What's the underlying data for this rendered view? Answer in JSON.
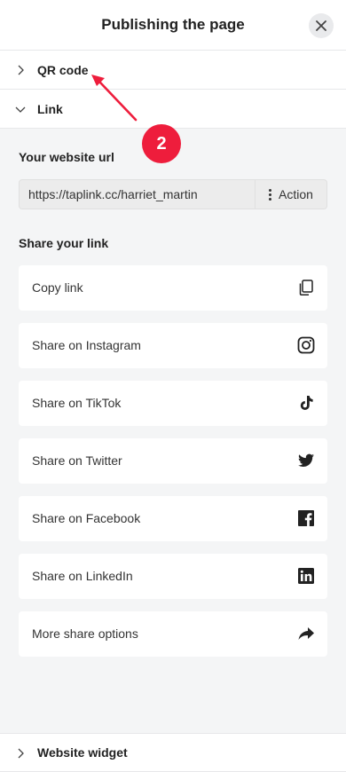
{
  "header": {
    "title": "Publishing the page"
  },
  "sections": {
    "qr": {
      "label": "QR code"
    },
    "link": {
      "label": "Link"
    },
    "widget": {
      "label": "Website widget"
    }
  },
  "website_url": {
    "label": "Your website url",
    "value": "https://taplink.cc/harriet_martin",
    "action_label": "Action"
  },
  "share": {
    "label": "Share your link",
    "items": [
      {
        "label": "Copy link",
        "icon": "copy-icon"
      },
      {
        "label": "Share on Instagram",
        "icon": "instagram-icon"
      },
      {
        "label": "Share on TikTok",
        "icon": "tiktok-icon"
      },
      {
        "label": "Share on Twitter",
        "icon": "twitter-icon"
      },
      {
        "label": "Share on Facebook",
        "icon": "facebook-icon"
      },
      {
        "label": "Share on LinkedIn",
        "icon": "linkedin-icon"
      },
      {
        "label": "More share options",
        "icon": "share-arrow-icon"
      }
    ]
  },
  "annotation": {
    "step_number": "2",
    "color": "#ee1d3c"
  }
}
